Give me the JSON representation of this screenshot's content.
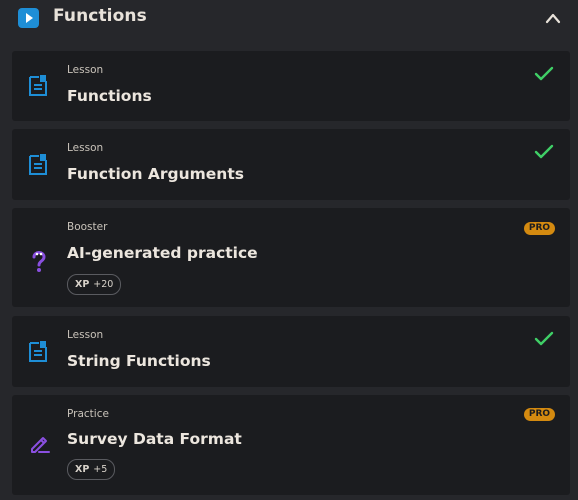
{
  "section": {
    "title": "Functions"
  },
  "items": [
    {
      "kind": "Lesson",
      "title": "Functions",
      "status": "completed",
      "icon": "lesson-doc-icon"
    },
    {
      "kind": "Lesson",
      "title": "Function Arguments",
      "status": "completed",
      "icon": "lesson-doc-icon"
    },
    {
      "kind": "Booster",
      "title": "AI-generated practice",
      "badge": "PRO",
      "xp_label": "XP",
      "xp_value": "+20",
      "icon": "question-mark-icon"
    },
    {
      "kind": "Lesson",
      "title": "String Functions",
      "status": "completed",
      "icon": "lesson-doc-icon"
    },
    {
      "kind": "Practice",
      "title": "Survey Data Format",
      "badge": "PRO",
      "xp_label": "XP",
      "xp_value": "+5",
      "icon": "pencil-edit-icon"
    }
  ],
  "colors": {
    "accent_blue": "#1e8ed6",
    "check_green": "#3fcf66",
    "pro_orange": "#d48a10",
    "booster_purple": "#8a4fe0"
  }
}
